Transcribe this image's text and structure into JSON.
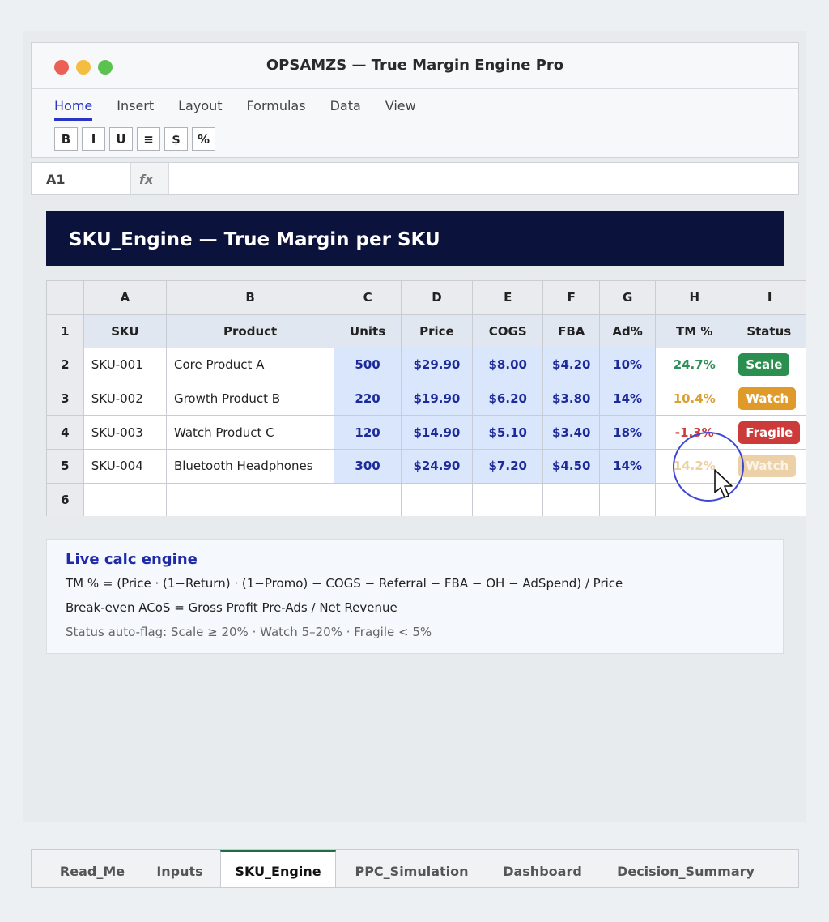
{
  "window": {
    "title": "OPSAMZS — True Margin Engine Pro"
  },
  "menu": [
    {
      "label": "Home",
      "active": true
    },
    {
      "label": "Insert"
    },
    {
      "label": "Layout"
    },
    {
      "label": "Formulas"
    },
    {
      "label": "Data"
    },
    {
      "label": "View"
    }
  ],
  "toolbar": {
    "bold": "B",
    "italic": "I",
    "underline": "U",
    "align": "≡",
    "currency": "$",
    "percent": "%"
  },
  "formula_bar": {
    "cell_ref": "A1",
    "fx_label": "fx",
    "formula": ""
  },
  "sheet": {
    "banner": "SKU_Engine — True Margin per SKU",
    "column_letters": [
      "A",
      "B",
      "C",
      "D",
      "E",
      "F",
      "G",
      "H",
      "I"
    ],
    "row_numbers": [
      "1",
      "2",
      "3",
      "4",
      "5",
      "6"
    ],
    "headers": [
      "SKU",
      "Product",
      "Units",
      "Price",
      "COGS",
      "FBA",
      "Ad%",
      "TM %",
      "Status"
    ],
    "rows": [
      {
        "sku": "SKU-001",
        "product": "Core Product A",
        "units": "500",
        "price": "$29.90",
        "cogs": "$8.00",
        "fba": "$4.20",
        "ad": "10%",
        "tm": "24.7%",
        "status": "Scale",
        "level": "scale"
      },
      {
        "sku": "SKU-002",
        "product": "Growth Product B",
        "units": "220",
        "price": "$19.90",
        "cogs": "$6.20",
        "fba": "$3.80",
        "ad": "14%",
        "tm": "10.4%",
        "status": "Watch",
        "level": "watch"
      },
      {
        "sku": "SKU-003",
        "product": "Watch Product C",
        "units": "120",
        "price": "$14.90",
        "cogs": "$5.10",
        "fba": "$3.40",
        "ad": "18%",
        "tm": "-1.3%",
        "status": "Fragile",
        "level": "fragile"
      },
      {
        "sku": "SKU-004",
        "product": "Bluetooth Headphones",
        "units": "300",
        "price": "$24.90",
        "cogs": "$7.20",
        "fba": "$4.50",
        "ad": "14%",
        "tm": "14.2%",
        "status": "Watch",
        "level": "faded"
      }
    ]
  },
  "calc": {
    "title": "Live calc engine",
    "tm_formula": "TM % =  (Price · (1−Return) · (1−Promo) − COGS − Referral − FBA − OH − AdSpend) / Price",
    "breakeven": "Break-even ACoS  =  Gross Profit Pre-Ads / Net Revenue",
    "status_rule": "Status auto-flag:  Scale ≥ 20%   ·   Watch 5–20%   ·   Fragile < 5%"
  },
  "tabs": [
    {
      "label": "Read_Me"
    },
    {
      "label": "Inputs"
    },
    {
      "label": "SKU_Engine",
      "active": true
    },
    {
      "label": "PPC_Simulation"
    },
    {
      "label": "Dashboard"
    },
    {
      "label": "Decision_Summary"
    }
  ],
  "colors": {
    "accent": "#2b35c4",
    "banner": "#0b123b",
    "scale": "#2a8f4f",
    "watch": "#e09a29",
    "fragile": "#cc3a3a",
    "active_tab": "#1d6e47"
  }
}
